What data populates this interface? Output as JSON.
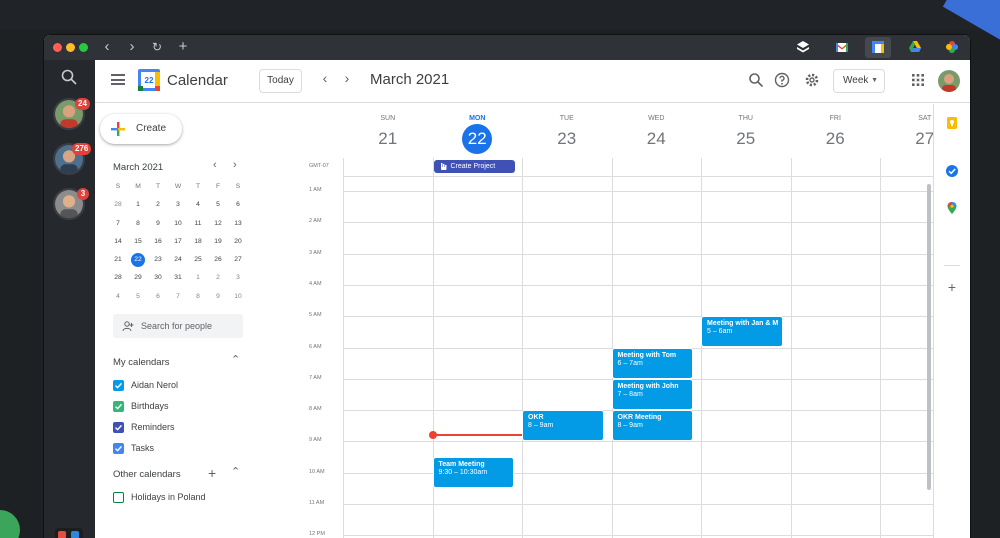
{
  "colors": {
    "accent": "#1a73e8",
    "event": "#039be5",
    "all_day_event": "#3f51b5",
    "now_indicator": "#ea4335",
    "calendar_aidan": "#039be5",
    "calendar_birthdays": "#33b679",
    "calendar_reminders": "#3f51b5",
    "calendar_tasks": "#4285f4",
    "calendar_holidays": "#0b8043"
  },
  "browser": {
    "toolbar_icons": [
      "layers-icon",
      "gmail-icon",
      "calendar-icon",
      "drive-icon",
      "photos-icon"
    ]
  },
  "rail": {
    "accounts": [
      {
        "badge": "24"
      },
      {
        "badge": "276"
      },
      {
        "badge": "3"
      }
    ]
  },
  "header": {
    "app_title": "Calendar",
    "logo_day": "22",
    "today_label": "Today",
    "period": "March 2021",
    "view_label": "Week"
  },
  "sidebar": {
    "create_label": "Create",
    "mini_month": "March 2021",
    "weekday_initials": [
      "S",
      "M",
      "T",
      "W",
      "T",
      "F",
      "S"
    ],
    "weeks": [
      [
        "28",
        "1",
        "2",
        "3",
        "4",
        "5",
        "6"
      ],
      [
        "7",
        "8",
        "9",
        "10",
        "11",
        "12",
        "13"
      ],
      [
        "14",
        "15",
        "16",
        "17",
        "18",
        "19",
        "20"
      ],
      [
        "21",
        "22",
        "23",
        "24",
        "25",
        "26",
        "27"
      ],
      [
        "28",
        "29",
        "30",
        "31",
        "1",
        "2",
        "3"
      ],
      [
        "4",
        "5",
        "6",
        "7",
        "8",
        "9",
        "10"
      ]
    ],
    "today": "22",
    "search_people_placeholder": "Search for people",
    "my_calendars_title": "My calendars",
    "my_calendars": [
      {
        "label": "Aidan Nerol",
        "checked": true
      },
      {
        "label": "Birthdays",
        "checked": true
      },
      {
        "label": "Reminders",
        "checked": true
      },
      {
        "label": "Tasks",
        "checked": true
      }
    ],
    "other_calendars_title": "Other calendars",
    "other_calendars": [
      {
        "label": "Holidays in Poland",
        "checked": false
      }
    ]
  },
  "week": {
    "timezone": "GMT-07",
    "days": [
      {
        "name": "SUN",
        "date": "21"
      },
      {
        "name": "MON",
        "date": "22",
        "today": true
      },
      {
        "name": "TUE",
        "date": "23"
      },
      {
        "name": "WED",
        "date": "24"
      },
      {
        "name": "THU",
        "date": "25"
      },
      {
        "name": "FRI",
        "date": "26"
      },
      {
        "name": "SAT",
        "date": "27"
      }
    ],
    "hours": [
      "1 AM",
      "2 AM",
      "3 AM",
      "4 AM",
      "5 AM",
      "6 AM",
      "7 AM",
      "8 AM",
      "9 AM",
      "10 AM",
      "11 AM",
      "12 PM"
    ],
    "all_day_events": [
      {
        "title": "Create Project",
        "day": 1
      }
    ],
    "events": [
      {
        "title": "Meeting with Jan & M",
        "time": "5 – 6am",
        "day": 4,
        "start": 5,
        "end": 6
      },
      {
        "title": "Meeting with Tom",
        "time": "6 – 7am",
        "day": 3,
        "start": 6,
        "end": 7
      },
      {
        "title": "Meeting with John",
        "time": "7 – 8am",
        "day": 3,
        "start": 7,
        "end": 8
      },
      {
        "title": "OKR",
        "time": "8 – 9am",
        "day": 2,
        "start": 8,
        "end": 9
      },
      {
        "title": "OKR Meeting",
        "time": "8 – 9am",
        "day": 3,
        "start": 8,
        "end": 9
      },
      {
        "title": "Team Meeting",
        "time": "9:30 – 10:30am",
        "day": 1,
        "start": 9.5,
        "end": 10.5
      }
    ],
    "now": {
      "day": 1,
      "hour": 8.77
    }
  },
  "side_panel": {
    "icons": [
      "keep-icon",
      "tasks-icon",
      "maps-icon",
      "add-addon-icon"
    ]
  }
}
